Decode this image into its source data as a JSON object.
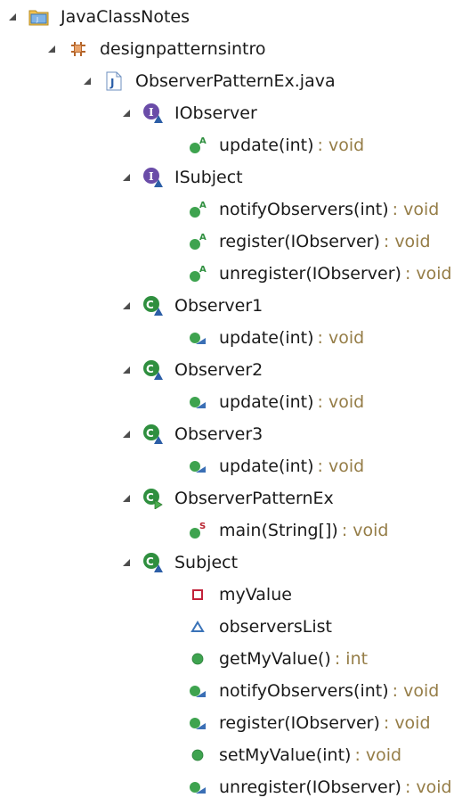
{
  "colors": {
    "return_type": "#957d47",
    "interface": "#6a4ca8",
    "class": "#2f8f3f",
    "method_public": "#3ea34f",
    "field_private": "#c2223a",
    "field_default": "#3a73b8",
    "package": "#b5652a"
  },
  "tree": [
    {
      "level": 0,
      "expanded": true,
      "icon": "project-icon",
      "label": "JavaClassNotes",
      "type": ""
    },
    {
      "level": 1,
      "expanded": true,
      "icon": "package-icon",
      "label": "designpatternsintro",
      "type": ""
    },
    {
      "level": 2,
      "expanded": true,
      "icon": "java-file-icon",
      "label": "ObserverPatternEx.java",
      "type": ""
    },
    {
      "level": 3,
      "expanded": true,
      "icon": "interface-icon",
      "label": "IObserver",
      "type": ""
    },
    {
      "level": 4,
      "icon": "abstract-method-icon",
      "label": "update(int)",
      "type": ": void"
    },
    {
      "level": 3,
      "expanded": true,
      "icon": "interface-icon",
      "label": "ISubject",
      "type": ""
    },
    {
      "level": 4,
      "icon": "abstract-method-icon",
      "label": "notifyObservers(int)",
      "type": ": void"
    },
    {
      "level": 4,
      "icon": "abstract-method-icon",
      "label": "register(IObserver)",
      "type": ": void"
    },
    {
      "level": 4,
      "icon": "abstract-method-icon",
      "label": "unregister(IObserver)",
      "type": ": void"
    },
    {
      "level": 3,
      "expanded": true,
      "icon": "class-icon",
      "label": "Observer1",
      "type": ""
    },
    {
      "level": 4,
      "icon": "implements-method-icon",
      "label": "update(int)",
      "type": ": void"
    },
    {
      "level": 3,
      "expanded": true,
      "icon": "class-icon",
      "label": "Observer2",
      "type": ""
    },
    {
      "level": 4,
      "icon": "implements-method-icon",
      "label": "update(int)",
      "type": ": void"
    },
    {
      "level": 3,
      "expanded": true,
      "icon": "class-icon",
      "label": "Observer3",
      "type": ""
    },
    {
      "level": 4,
      "icon": "implements-method-icon",
      "label": "update(int)",
      "type": ": void"
    },
    {
      "level": 3,
      "expanded": true,
      "icon": "main-class-icon",
      "label": "ObserverPatternEx",
      "type": ""
    },
    {
      "level": 4,
      "icon": "static-method-icon",
      "label": "main(String[])",
      "type": ": void"
    },
    {
      "level": 3,
      "expanded": true,
      "icon": "class-icon",
      "label": "Subject",
      "type": ""
    },
    {
      "level": 4,
      "icon": "private-field-icon",
      "label": "myValue",
      "type": ""
    },
    {
      "level": 4,
      "icon": "default-field-icon",
      "label": "observersList",
      "type": ""
    },
    {
      "level": 4,
      "icon": "public-method-icon",
      "label": "getMyValue()",
      "type": ": int"
    },
    {
      "level": 4,
      "icon": "implements-method-icon",
      "label": "notifyObservers(int)",
      "type": ": void"
    },
    {
      "level": 4,
      "icon": "implements-method-icon",
      "label": "register(IObserver)",
      "type": ": void"
    },
    {
      "level": 4,
      "icon": "public-method-icon",
      "label": "setMyValue(int)",
      "type": ": void"
    },
    {
      "level": 4,
      "icon": "implements-method-icon",
      "label": "unregister(IObserver)",
      "type": ": void"
    }
  ]
}
